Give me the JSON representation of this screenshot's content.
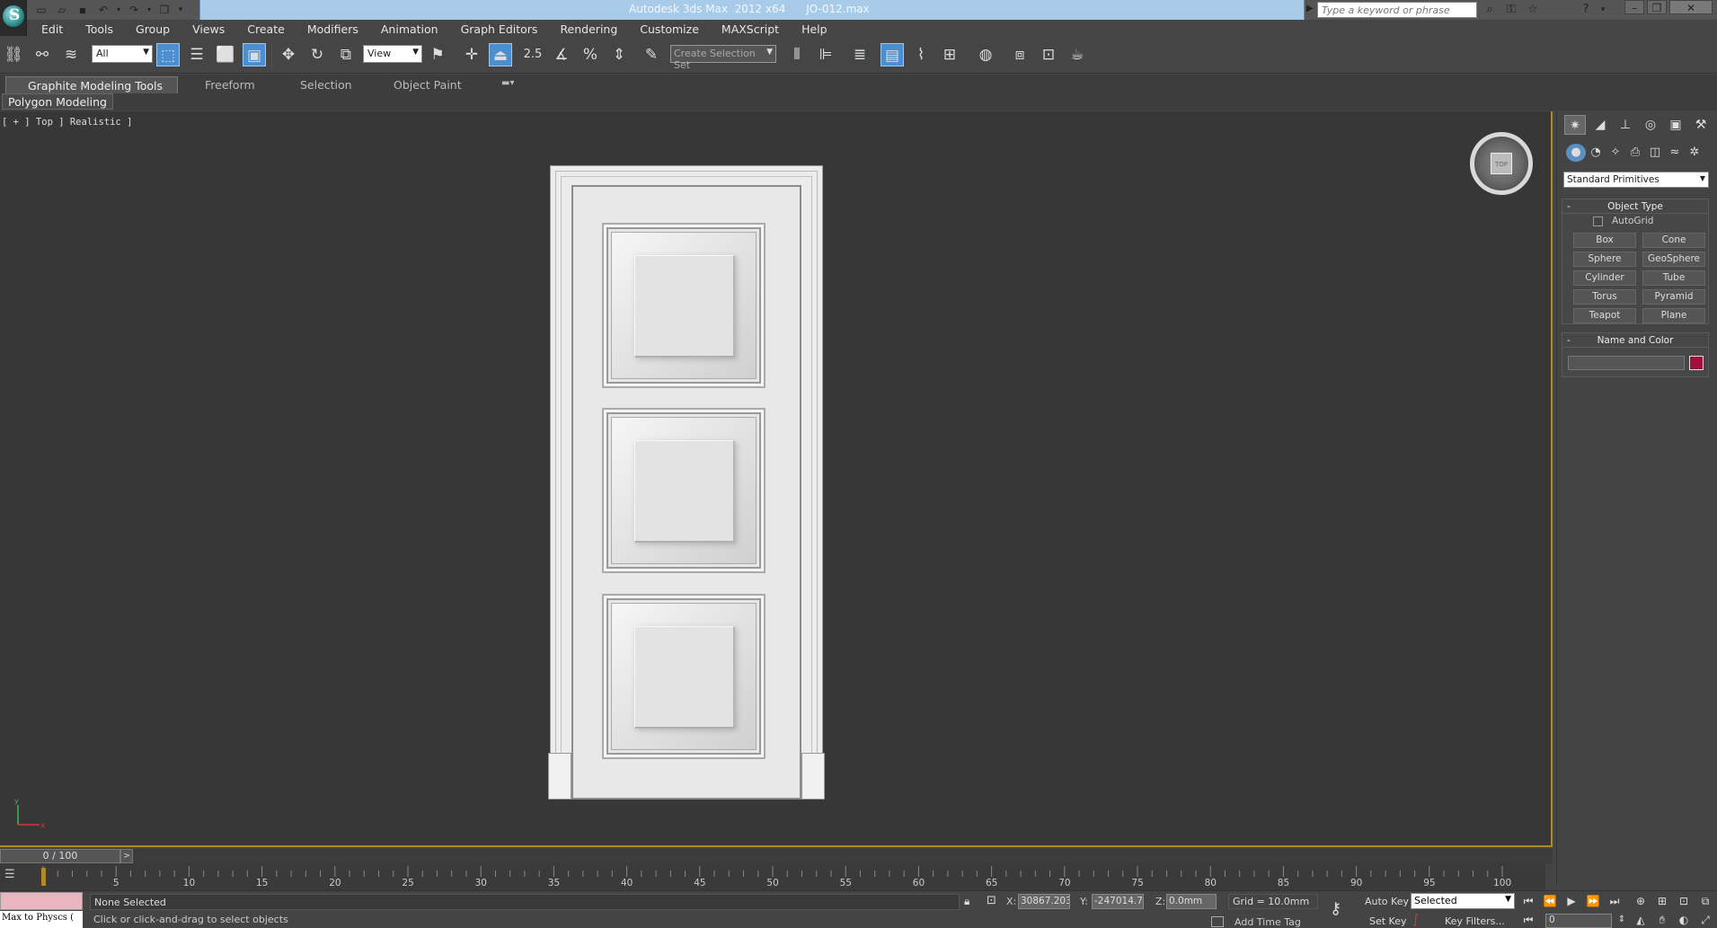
{
  "title_bar": {
    "title": "Autodesk 3ds Max  2012 x64      JO-012.max",
    "search_placeholder": "Type a keyword or phrase"
  },
  "menu": [
    "Edit",
    "Tools",
    "Group",
    "Views",
    "Create",
    "Modifiers",
    "Animation",
    "Graph Editors",
    "Rendering",
    "Customize",
    "MAXScript",
    "Help"
  ],
  "main_toolbar": {
    "selection_filter": "All",
    "reference_coord": "View",
    "snap_label": "2.5",
    "named_selection_placeholder": "Create Selection Set"
  },
  "ribbon": {
    "tabs": [
      "Graphite Modeling Tools",
      "Freeform",
      "Selection",
      "Object Paint"
    ],
    "active_tab": "Graphite Modeling Tools",
    "sub_panel": "Polygon Modeling"
  },
  "viewport": {
    "label": "[ + ] Top ] Realistic ]",
    "viewcube_face": "TOP"
  },
  "command_panel": {
    "category": "Standard Primitives",
    "object_type_title": "Object Type",
    "autogrid_label": "AutoGrid",
    "primitives": [
      "Box",
      "Cone",
      "Sphere",
      "GeoSphere",
      "Cylinder",
      "Tube",
      "Torus",
      "Pyramid",
      "Teapot",
      "Plane"
    ],
    "name_color_title": "Name and Color",
    "object_color": "#a0103a"
  },
  "timeline": {
    "slider_label": "0 / 100",
    "ticks": [
      "5",
      "10",
      "15",
      "20",
      "25",
      "30",
      "35",
      "40",
      "45",
      "50",
      "55",
      "60",
      "65",
      "70",
      "75",
      "80",
      "85",
      "90",
      "95",
      "100"
    ]
  },
  "status_bar": {
    "maxscript_text": "Max to Physcs (",
    "selection_status": "None Selected",
    "prompt": "Click or click-and-drag to select objects",
    "x_label": "X:",
    "x_value": "30867.203",
    "y_label": "Y:",
    "y_value": "-247014.7",
    "z_label": "Z:",
    "z_value": "0.0mm",
    "grid": "Grid = 10.0mm",
    "add_time_tag": "Add Time Tag",
    "auto_key": "Auto Key",
    "set_key": "Set Key",
    "key_mode": "Selected",
    "key_filters": "Key Filters...",
    "current_frame": "0"
  }
}
